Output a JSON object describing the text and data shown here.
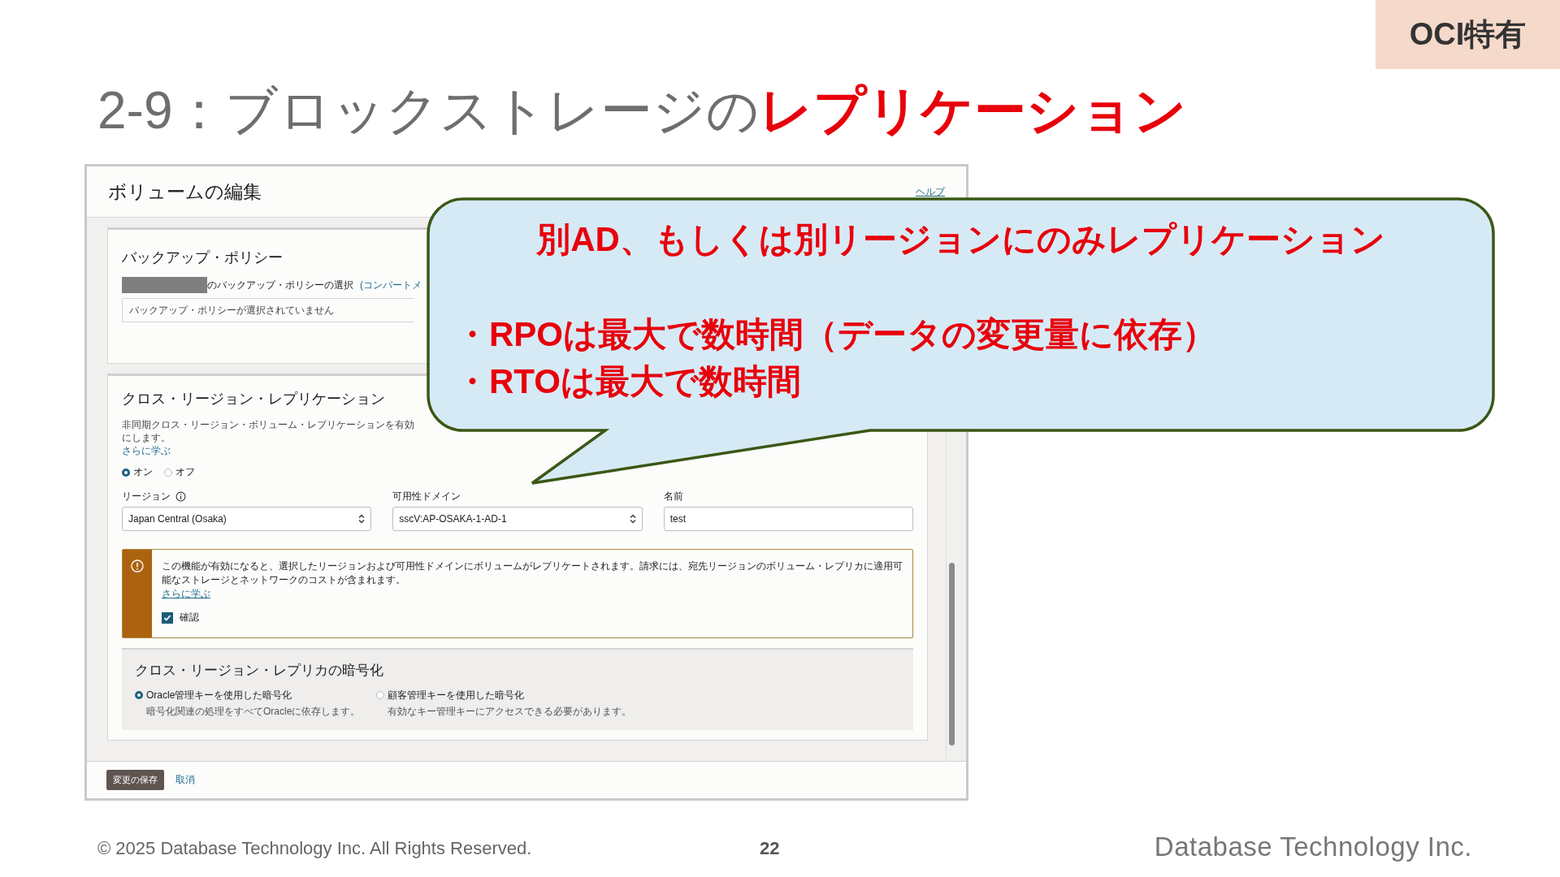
{
  "badge": "OCI特有",
  "title": {
    "plain": "2-9：ブロックストレージの",
    "highlight": "レプリケーション"
  },
  "dialog": {
    "title": "ボリュームの編集",
    "help_link": "ヘルプ",
    "backup_policy": {
      "heading": "バックアップ・ポリシー",
      "select_label": "のバックアップ・ポリシーの選択",
      "compartment_link": "(コンパートメ",
      "value": "バックアップ・ポリシーが選択されていません"
    },
    "cross_region": {
      "heading": "クロス・リージョン・レプリケーション",
      "description": "非同期クロス・リージョン・ボリューム・レプリケーションを有効にします。",
      "learn_more": "さらに学ぶ",
      "toggle": [
        {
          "label": "オン",
          "selected": true
        },
        {
          "label": "オフ",
          "selected": false
        }
      ],
      "fields": [
        {
          "kind": "select",
          "label": "リージョン",
          "info": true,
          "value": "Japan Central (Osaka)"
        },
        {
          "kind": "select",
          "label": "可用性ドメイン",
          "info": false,
          "value": "sscV:AP-OSAKA-1-AD-1"
        },
        {
          "kind": "text",
          "label": "名前",
          "info": false,
          "value": "test"
        }
      ],
      "warning": {
        "text": "この機能が有効になると、選択したリージョンおよび可用性ドメインにボリュームがレプリケートされます。請求には、宛先リージョンのボリューム・レプリカに適用可能なストレージとネットワークのコストが含まれます。",
        "learn_more": "さらに学ぶ",
        "confirm": {
          "label": "確認",
          "checked": true
        }
      },
      "encryption": {
        "heading": "クロス・リージョン・レプリカの暗号化",
        "options": [
          {
            "label": "Oracle管理キーを使用した暗号化",
            "hint": "暗号化関連の処理をすべてOracleに依存します。",
            "selected": true
          },
          {
            "label": "顧客管理キーを使用した暗号化",
            "hint": "有効なキー管理キーにアクセスできる必要があります。",
            "selected": false
          }
        ]
      }
    },
    "buttons": {
      "save": "変更の保存",
      "cancel": "取消"
    }
  },
  "callout": {
    "heading": "別AD、もしくは別リージョンにのみレプリケーション",
    "bullets": [
      "・RPOは最大で数時間（データの変更量に依存）",
      "・RTOは最大で数時間"
    ]
  },
  "footer": {
    "copyright": "© 2025 Database Technology Inc. All Rights Reserved.",
    "page": "22",
    "logo": "Database Technology Inc."
  }
}
